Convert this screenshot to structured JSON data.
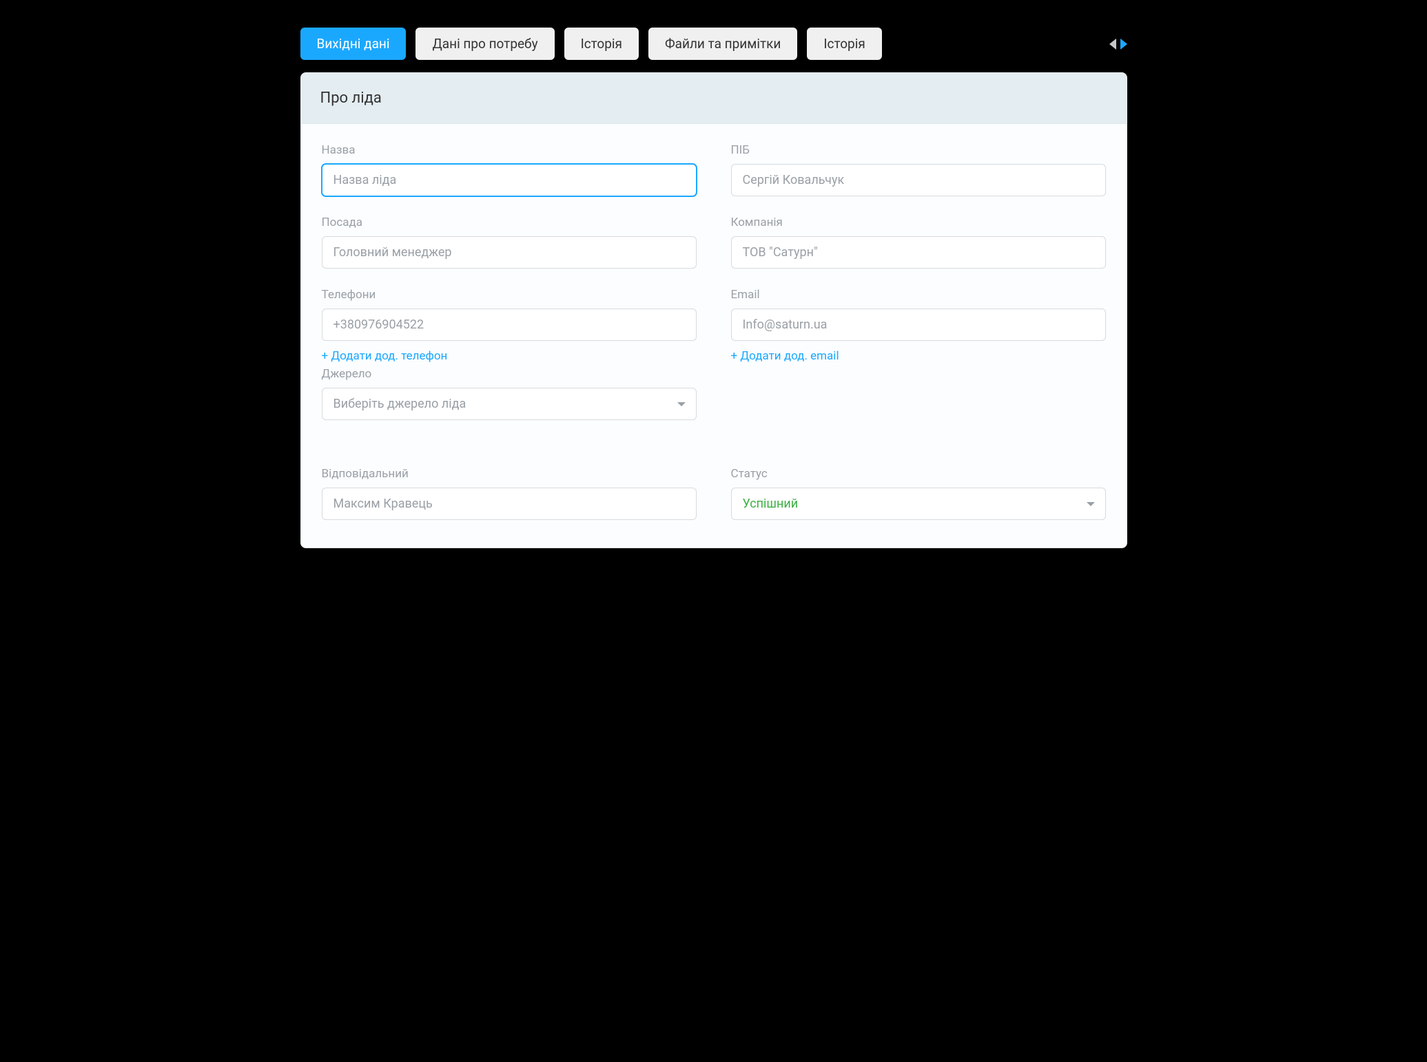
{
  "tabs": {
    "items": [
      {
        "label": "Вихідні дані",
        "active": true
      },
      {
        "label": "Дані про потребу"
      },
      {
        "label": "Історія"
      },
      {
        "label": "Файли та примітки"
      },
      {
        "label": "Історія"
      }
    ]
  },
  "card": {
    "title": "Про ліда"
  },
  "form": {
    "name": {
      "label": "Назва",
      "placeholder": "Назва ліда",
      "value": ""
    },
    "fullname": {
      "label": "ПІБ",
      "value": "Сергій Ковальчук"
    },
    "position": {
      "label": "Посада",
      "value": "Головний менеджер"
    },
    "company": {
      "label": "Компанія",
      "value": "ТОВ \"Сатурн\""
    },
    "phones": {
      "label": "Телефони",
      "value": "+380976904522",
      "add_label": "+ Додати дод. телефон"
    },
    "email": {
      "label": "Email",
      "value": "Info@saturn.ua",
      "add_label": "+ Додати дод. email"
    },
    "source": {
      "label": "Джерело",
      "placeholder": "Виберіть джерело ліда"
    },
    "responsible": {
      "label": "Відповідальний",
      "value": "Максим Кравець"
    },
    "status": {
      "label": "Статус",
      "value": "Успішний"
    }
  }
}
